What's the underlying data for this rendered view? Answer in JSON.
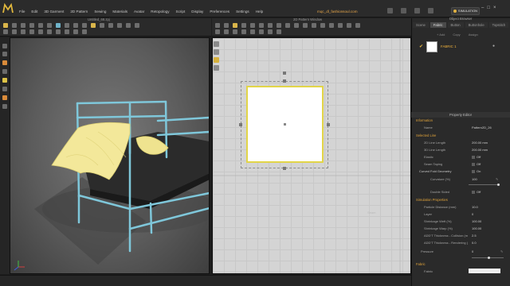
{
  "app": {
    "menus": [
      "File",
      "Edit",
      "3D Garment",
      "2D Pattern",
      "Sewing",
      "Materials",
      "Avatar",
      "Retopology",
      "Script",
      "Display",
      "Preferences",
      "Settings",
      "Help"
    ],
    "user": "mqc_dl_fashionsoul.com",
    "mode_label": "SIMULATION"
  },
  "viewport3d": {
    "title": "Untitled_68.zpj",
    "colors": {
      "frame": "#7cc6d8",
      "mattress": "#2c2c2c",
      "fabric": "#f2e89a",
      "pillow": "#f2e89a"
    }
  },
  "viewport2d": {
    "title": "2D Pattern Window",
    "faded_label": "Seam"
  },
  "object_browser": {
    "header": "Object Browser",
    "tabs": [
      "Scene",
      "Fabric",
      "Button",
      "Buttonhole",
      "Topstitch"
    ],
    "active_tab": "Fabric",
    "actions": [
      "+ Add",
      "Copy",
      "Assign"
    ],
    "fabric_name": "FABRIC 1"
  },
  "property_editor": {
    "header": "Property Editor",
    "information_label": "Information",
    "name_label": "Name",
    "name_value": "Pattern2D_26",
    "selected_line_label": "Selected Line",
    "line_length_2d_label": "2D Line Length",
    "line_length_2d_value": "200.00 mm",
    "line_length_3d_label": "3D Line Length",
    "line_length_3d_value": "200.00 mm",
    "elastic_label": "Elastic",
    "elastic_value": "Off",
    "seam_taping_label": "Seam Taping",
    "seam_taping_value": "Off",
    "curved_fold_label": "Curved Fold Geometry",
    "curved_fold_value": "On",
    "curvature_label": "Curvature (%)",
    "curvature_value": "100",
    "double_sided_label": "Double Sided",
    "double_sided_value": "Off",
    "sim_props_label": "Simulation Properties",
    "particle_label": "Particle Distance (mm)",
    "particle_value": "10.0",
    "layer_label": "Layer",
    "layer_value": "0",
    "shrink_weft_label": "Shrinkage Weft (%)",
    "shrink_weft_value": "100.00",
    "shrink_warp_label": "Shrinkage Warp (%)",
    "shrink_warp_value": "100.00",
    "add_coll_label": "ADD'T Thickness - Collision (m",
    "add_coll_value": "2.5",
    "add_rend_label": "ADD'T Thickness - Rendering (",
    "add_rend_value": "0.0",
    "pressure_label": "Pressure",
    "pressure_value": "0",
    "fabric_label": "Fabric",
    "fabric_sub_label": "Fabric"
  }
}
